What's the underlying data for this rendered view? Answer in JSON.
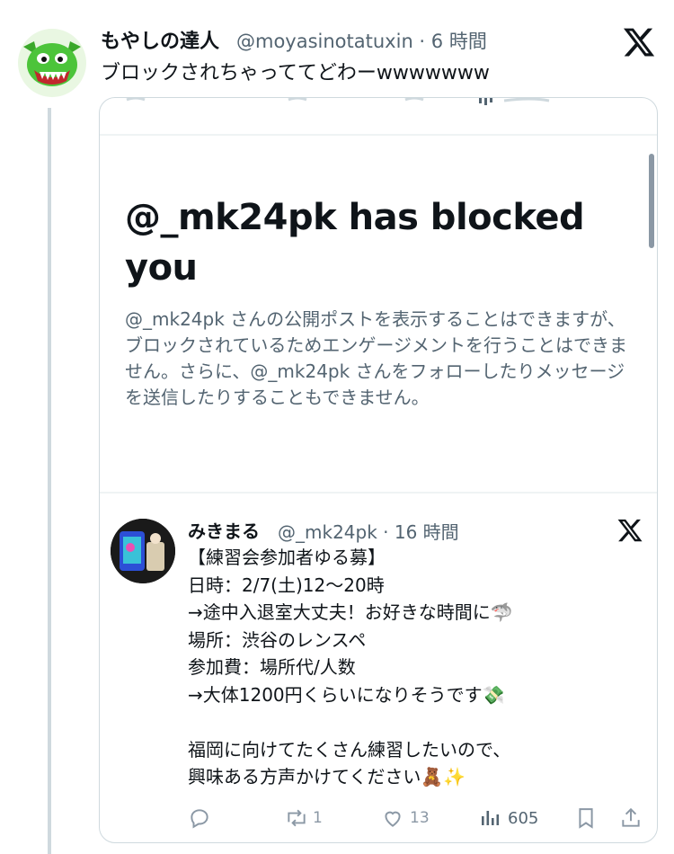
{
  "outer_tweet": {
    "author_name": "もやしの達人",
    "handle_time": "@moyasinotatuxin · 6 時間",
    "text": "ブロックされちゃっててどわーwwwwwww"
  },
  "card": {
    "block_title": "@_mk24pk has blocked you",
    "block_body": "@_mk24pk さんの公開ポストを表示することはできますが、ブロックされているためエンゲージメントを行うことはできません。さらに、@_mk24pk さんをフォローしたりメッセージを送信したりすることもできません。"
  },
  "quoted_tweet": {
    "author_name": "みきまる",
    "handle_time": "@_mk24pk · 16 時間",
    "lines": [
      "【練習会参加者ゆる募】",
      "日時：2/7(土)12〜20時",
      "→途中入退室大丈夫！お好きな時間に🦈",
      "場所：渋谷のレンスペ",
      "参加費：場所代/人数",
      "→大体1200円くらいになりそうです💸",
      "",
      "福岡に向けてたくさん練習したいので、",
      "興味ある方声かけてください🧸✨"
    ]
  },
  "actions": {
    "retweets": "1",
    "likes": "13",
    "views": "605"
  },
  "icons": {
    "reply": "reply-icon",
    "retweet": "retweet-icon",
    "like": "heart-icon",
    "views": "views-icon",
    "bookmark": "bookmark-icon",
    "share": "share-icon",
    "x_logo": "x-logo-icon"
  },
  "colors": {
    "text": "#0f1419",
    "secondary": "#536471",
    "icon": "#8b98a5",
    "border": "#cfd9de"
  }
}
